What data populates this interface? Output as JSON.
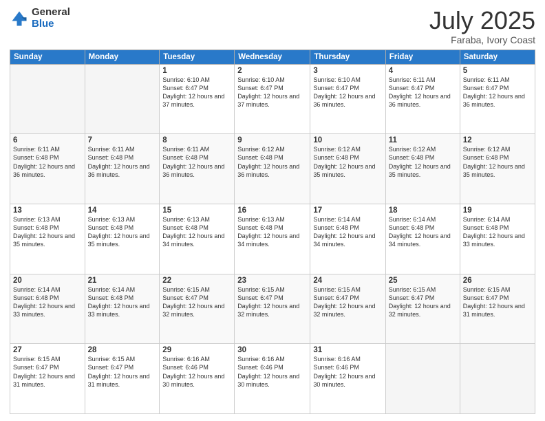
{
  "logo": {
    "general": "General",
    "blue": "Blue"
  },
  "header": {
    "month": "July 2025",
    "location": "Faraba, Ivory Coast"
  },
  "weekdays": [
    "Sunday",
    "Monday",
    "Tuesday",
    "Wednesday",
    "Thursday",
    "Friday",
    "Saturday"
  ],
  "weeks": [
    [
      {
        "day": "",
        "empty": true
      },
      {
        "day": "",
        "empty": true
      },
      {
        "day": "1",
        "sunrise": "Sunrise: 6:10 AM",
        "sunset": "Sunset: 6:47 PM",
        "daylight": "Daylight: 12 hours and 37 minutes."
      },
      {
        "day": "2",
        "sunrise": "Sunrise: 6:10 AM",
        "sunset": "Sunset: 6:47 PM",
        "daylight": "Daylight: 12 hours and 37 minutes."
      },
      {
        "day": "3",
        "sunrise": "Sunrise: 6:10 AM",
        "sunset": "Sunset: 6:47 PM",
        "daylight": "Daylight: 12 hours and 36 minutes."
      },
      {
        "day": "4",
        "sunrise": "Sunrise: 6:11 AM",
        "sunset": "Sunset: 6:47 PM",
        "daylight": "Daylight: 12 hours and 36 minutes."
      },
      {
        "day": "5",
        "sunrise": "Sunrise: 6:11 AM",
        "sunset": "Sunset: 6:47 PM",
        "daylight": "Daylight: 12 hours and 36 minutes."
      }
    ],
    [
      {
        "day": "6",
        "sunrise": "Sunrise: 6:11 AM",
        "sunset": "Sunset: 6:48 PM",
        "daylight": "Daylight: 12 hours and 36 minutes."
      },
      {
        "day": "7",
        "sunrise": "Sunrise: 6:11 AM",
        "sunset": "Sunset: 6:48 PM",
        "daylight": "Daylight: 12 hours and 36 minutes."
      },
      {
        "day": "8",
        "sunrise": "Sunrise: 6:11 AM",
        "sunset": "Sunset: 6:48 PM",
        "daylight": "Daylight: 12 hours and 36 minutes."
      },
      {
        "day": "9",
        "sunrise": "Sunrise: 6:12 AM",
        "sunset": "Sunset: 6:48 PM",
        "daylight": "Daylight: 12 hours and 36 minutes."
      },
      {
        "day": "10",
        "sunrise": "Sunrise: 6:12 AM",
        "sunset": "Sunset: 6:48 PM",
        "daylight": "Daylight: 12 hours and 35 minutes."
      },
      {
        "day": "11",
        "sunrise": "Sunrise: 6:12 AM",
        "sunset": "Sunset: 6:48 PM",
        "daylight": "Daylight: 12 hours and 35 minutes."
      },
      {
        "day": "12",
        "sunrise": "Sunrise: 6:12 AM",
        "sunset": "Sunset: 6:48 PM",
        "daylight": "Daylight: 12 hours and 35 minutes."
      }
    ],
    [
      {
        "day": "13",
        "sunrise": "Sunrise: 6:13 AM",
        "sunset": "Sunset: 6:48 PM",
        "daylight": "Daylight: 12 hours and 35 minutes."
      },
      {
        "day": "14",
        "sunrise": "Sunrise: 6:13 AM",
        "sunset": "Sunset: 6:48 PM",
        "daylight": "Daylight: 12 hours and 35 minutes."
      },
      {
        "day": "15",
        "sunrise": "Sunrise: 6:13 AM",
        "sunset": "Sunset: 6:48 PM",
        "daylight": "Daylight: 12 hours and 34 minutes."
      },
      {
        "day": "16",
        "sunrise": "Sunrise: 6:13 AM",
        "sunset": "Sunset: 6:48 PM",
        "daylight": "Daylight: 12 hours and 34 minutes."
      },
      {
        "day": "17",
        "sunrise": "Sunrise: 6:14 AM",
        "sunset": "Sunset: 6:48 PM",
        "daylight": "Daylight: 12 hours and 34 minutes."
      },
      {
        "day": "18",
        "sunrise": "Sunrise: 6:14 AM",
        "sunset": "Sunset: 6:48 PM",
        "daylight": "Daylight: 12 hours and 34 minutes."
      },
      {
        "day": "19",
        "sunrise": "Sunrise: 6:14 AM",
        "sunset": "Sunset: 6:48 PM",
        "daylight": "Daylight: 12 hours and 33 minutes."
      }
    ],
    [
      {
        "day": "20",
        "sunrise": "Sunrise: 6:14 AM",
        "sunset": "Sunset: 6:48 PM",
        "daylight": "Daylight: 12 hours and 33 minutes."
      },
      {
        "day": "21",
        "sunrise": "Sunrise: 6:14 AM",
        "sunset": "Sunset: 6:48 PM",
        "daylight": "Daylight: 12 hours and 33 minutes."
      },
      {
        "day": "22",
        "sunrise": "Sunrise: 6:15 AM",
        "sunset": "Sunset: 6:47 PM",
        "daylight": "Daylight: 12 hours and 32 minutes."
      },
      {
        "day": "23",
        "sunrise": "Sunrise: 6:15 AM",
        "sunset": "Sunset: 6:47 PM",
        "daylight": "Daylight: 12 hours and 32 minutes."
      },
      {
        "day": "24",
        "sunrise": "Sunrise: 6:15 AM",
        "sunset": "Sunset: 6:47 PM",
        "daylight": "Daylight: 12 hours and 32 minutes."
      },
      {
        "day": "25",
        "sunrise": "Sunrise: 6:15 AM",
        "sunset": "Sunset: 6:47 PM",
        "daylight": "Daylight: 12 hours and 32 minutes."
      },
      {
        "day": "26",
        "sunrise": "Sunrise: 6:15 AM",
        "sunset": "Sunset: 6:47 PM",
        "daylight": "Daylight: 12 hours and 31 minutes."
      }
    ],
    [
      {
        "day": "27",
        "sunrise": "Sunrise: 6:15 AM",
        "sunset": "Sunset: 6:47 PM",
        "daylight": "Daylight: 12 hours and 31 minutes."
      },
      {
        "day": "28",
        "sunrise": "Sunrise: 6:15 AM",
        "sunset": "Sunset: 6:47 PM",
        "daylight": "Daylight: 12 hours and 31 minutes."
      },
      {
        "day": "29",
        "sunrise": "Sunrise: 6:16 AM",
        "sunset": "Sunset: 6:46 PM",
        "daylight": "Daylight: 12 hours and 30 minutes."
      },
      {
        "day": "30",
        "sunrise": "Sunrise: 6:16 AM",
        "sunset": "Sunset: 6:46 PM",
        "daylight": "Daylight: 12 hours and 30 minutes."
      },
      {
        "day": "31",
        "sunrise": "Sunrise: 6:16 AM",
        "sunset": "Sunset: 6:46 PM",
        "daylight": "Daylight: 12 hours and 30 minutes."
      },
      {
        "day": "",
        "empty": true
      },
      {
        "day": "",
        "empty": true
      }
    ]
  ]
}
